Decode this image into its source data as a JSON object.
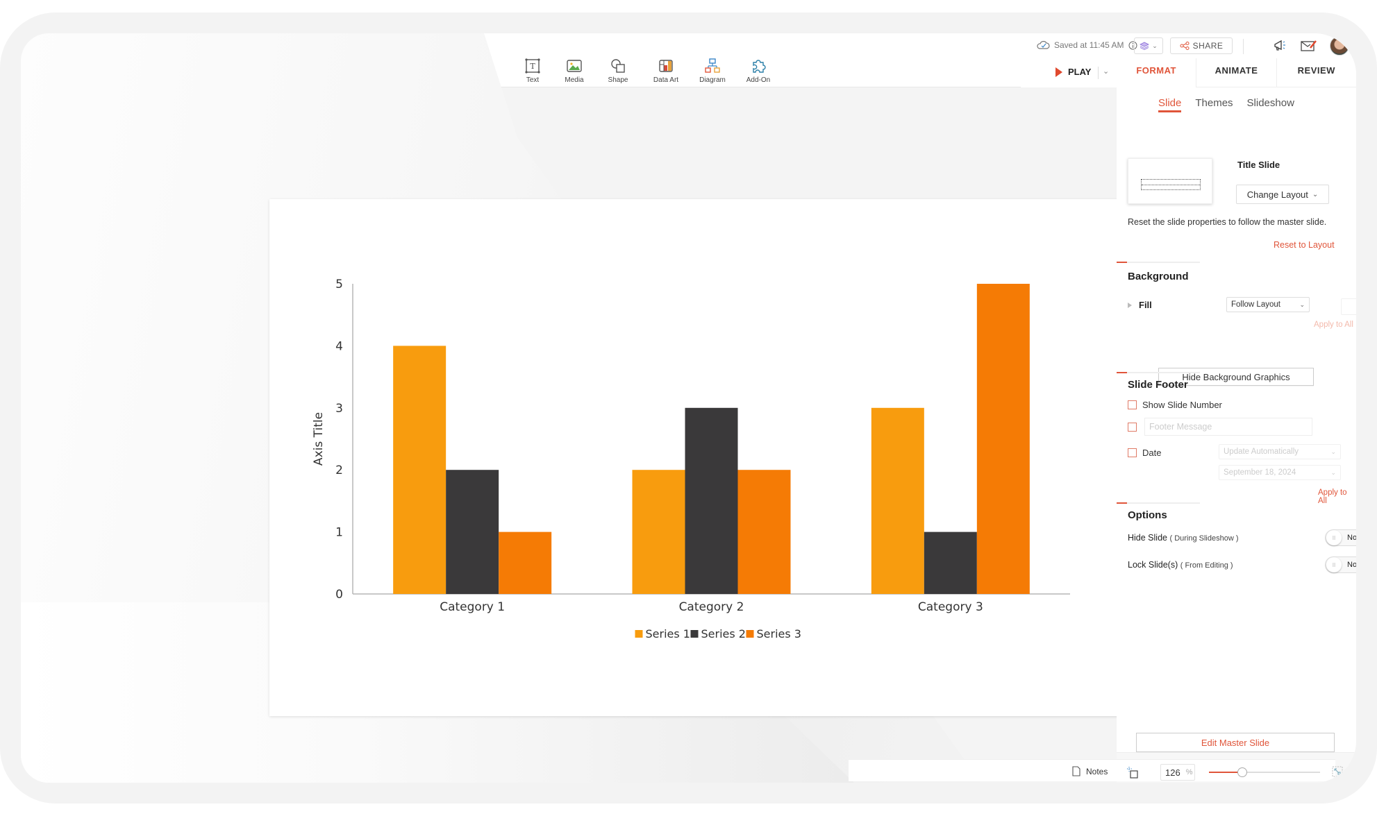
{
  "toolbar": {
    "tools": [
      {
        "label": "Text",
        "icon": "text-box-icon"
      },
      {
        "label": "Media",
        "icon": "image-icon"
      },
      {
        "label": "Shape",
        "icon": "shape-icon"
      },
      {
        "label": "Data Art",
        "icon": "data-art-icon"
      },
      {
        "label": "Diagram",
        "icon": "diagram-icon"
      },
      {
        "label": "Add-On",
        "icon": "puzzle-icon"
      }
    ]
  },
  "topbar": {
    "saved_text": "Saved at 11:45 AM",
    "share_label": "SHARE",
    "play_label": "PLAY"
  },
  "panel": {
    "tabs": [
      "FORMAT",
      "ANIMATE",
      "REVIEW"
    ],
    "active_tab": "FORMAT",
    "sub_tabs": [
      "Slide",
      "Themes",
      "Slideshow"
    ],
    "active_sub_tab": "Slide",
    "layout_name": "Title Slide",
    "change_layout_label": "Change Layout",
    "reset_description": "Reset the slide properties to follow the master slide.",
    "reset_link": "Reset to Layout",
    "background": {
      "title": "Background",
      "fill_label": "Fill",
      "fill_value": "Follow Layout",
      "apply_all": "Apply to All",
      "hide_bg_graphics": "Hide Background Graphics"
    },
    "footer": {
      "title": "Slide Footer",
      "show_slide_number": "Show Slide Number",
      "footer_message_placeholder": "Footer Message",
      "date_label": "Date",
      "date_mode": "Update Automatically",
      "date_value": "September 18, 2024",
      "apply_all": "Apply to All"
    },
    "options": {
      "title": "Options",
      "hide_slide": "Hide Slide",
      "hide_slide_note": "( During Slideshow )",
      "hide_slide_value": "No",
      "lock_slide": "Lock Slide(s)",
      "lock_slide_note": "( From Editing )",
      "lock_slide_value": "No"
    },
    "edit_master": "Edit Master Slide"
  },
  "statusbar": {
    "notes_label": "Notes",
    "zoom_value": "126",
    "zoom_unit": "%",
    "zoom_slider_fraction": 0.3
  },
  "colors": {
    "accent": "#e0553a",
    "series1": "#f89c0e",
    "series2": "#3a393a",
    "series3": "#f57b05"
  },
  "chart_data": {
    "type": "bar",
    "title": "",
    "categories": [
      "Category 1",
      "Category 2",
      "Category 3"
    ],
    "series": [
      {
        "name": "Series 1",
        "values": [
          4,
          2,
          3
        ]
      },
      {
        "name": "Series 2",
        "values": [
          2,
          3,
          1
        ]
      },
      {
        "name": "Series 3",
        "values": [
          1,
          2,
          5
        ]
      }
    ],
    "xlabel": "",
    "ylabel": "Axis Title",
    "ylim": [
      0,
      5
    ],
    "yticks": [
      0,
      1,
      2,
      3,
      4,
      5
    ],
    "grid": false,
    "legend": "bottom"
  }
}
